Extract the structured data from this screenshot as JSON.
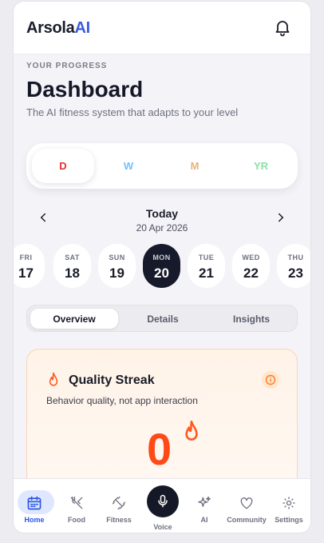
{
  "app": {
    "brand_main": "Arsola",
    "brand_accent": "AI"
  },
  "page": {
    "eyebrow": "YOUR PROGRESS",
    "title": "Dashboard",
    "subtitle": "The AI fitness system that adapts to your level"
  },
  "range": {
    "options": [
      {
        "label": "D",
        "color": "#e03131",
        "active": true
      },
      {
        "label": "W",
        "color": "#74c0fc",
        "active": false
      },
      {
        "label": "M",
        "color": "#e8b27a",
        "active": false
      },
      {
        "label": "YR",
        "color": "#8ce0a6",
        "active": false
      }
    ]
  },
  "date_nav": {
    "today_label": "Today",
    "date": "20 Apr 2026"
  },
  "days": [
    {
      "name": "FRI",
      "date": "17"
    },
    {
      "name": "SAT",
      "date": "18"
    },
    {
      "name": "SUN",
      "date": "19"
    },
    {
      "name": "MON",
      "date": "20",
      "active": true
    },
    {
      "name": "TUE",
      "date": "21"
    },
    {
      "name": "WED",
      "date": "22"
    },
    {
      "name": "THU",
      "date": "23"
    }
  ],
  "tabs": [
    {
      "label": "Overview",
      "active": true
    },
    {
      "label": "Details"
    },
    {
      "label": "Insights"
    }
  ],
  "streak": {
    "title": "Quality Streak",
    "description": "Behavior quality, not app interaction",
    "value": "0"
  },
  "bottom_nav": [
    {
      "label": "Home",
      "icon": "calendar-icon",
      "active": true
    },
    {
      "label": "Food",
      "icon": "utensils-icon"
    },
    {
      "label": "Fitness",
      "icon": "dumbbell-icon"
    },
    {
      "label": "Voice",
      "icon": "microphone-icon"
    },
    {
      "label": "AI",
      "icon": "sparkles-icon"
    },
    {
      "label": "Community",
      "icon": "heart-icon"
    },
    {
      "label": "Settings",
      "icon": "gear-icon"
    }
  ],
  "colors": {
    "accent": "#3b5bdb",
    "streak_orange": "#ff4a17",
    "dark": "#161a2b"
  }
}
